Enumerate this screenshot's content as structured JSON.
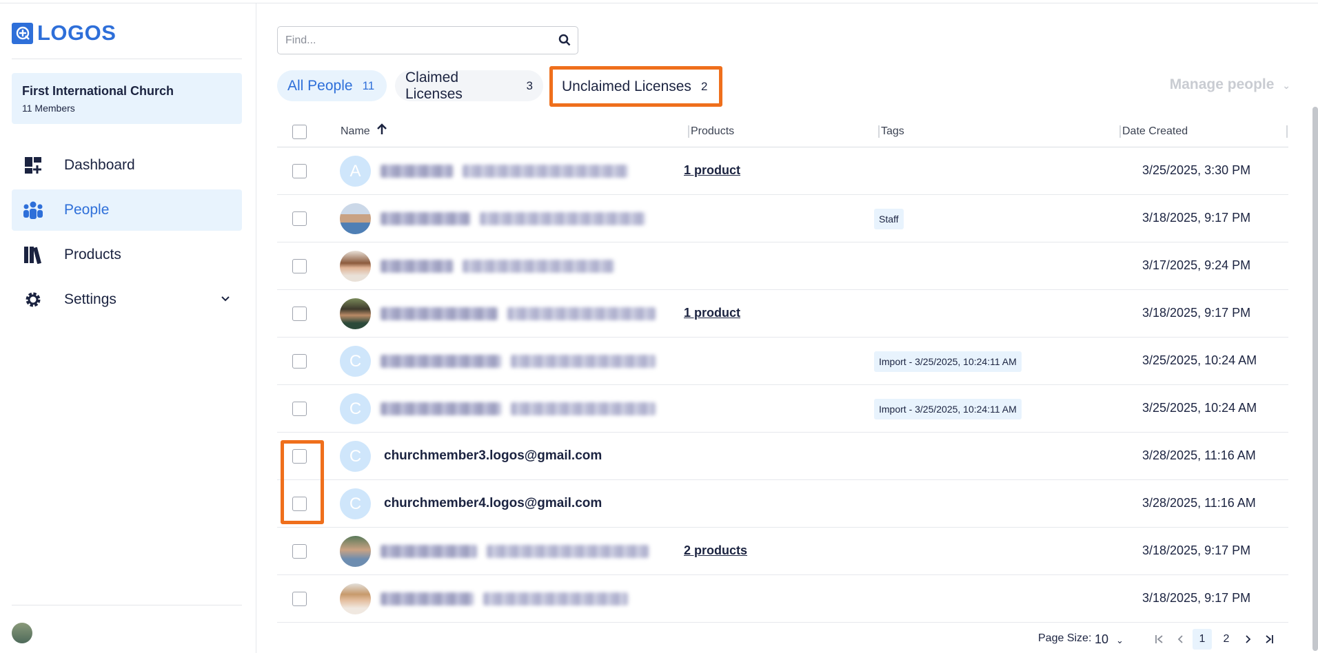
{
  "app": {
    "logo_text": "LOGOS"
  },
  "sidebar": {
    "org_name": "First International Church",
    "org_members": "11 Members",
    "items": [
      {
        "label": "Dashboard",
        "icon": "dashboard-icon"
      },
      {
        "label": "People",
        "icon": "people-icon",
        "active": true
      },
      {
        "label": "Products",
        "icon": "books-icon"
      },
      {
        "label": "Settings",
        "icon": "gear-icon"
      }
    ]
  },
  "search": {
    "placeholder": "Find..."
  },
  "tabs": [
    {
      "label": "All People",
      "count": "11",
      "active": true
    },
    {
      "label": "Claimed Licenses",
      "count": "3"
    },
    {
      "label": "Unclaimed Licenses",
      "count": "2",
      "highlighted": true
    }
  ],
  "manage_label": "Manage people",
  "columns": {
    "name": "Name",
    "products": "Products",
    "tags": "Tags",
    "date": "Date Created"
  },
  "rows": [
    {
      "avatar": "A",
      "name_visible": false,
      "products": "1 product",
      "tag": "",
      "date": "3/25/2025, 3:30 PM"
    },
    {
      "avatar": "photo",
      "name_visible": false,
      "products": "",
      "tag": "Staff",
      "date": "3/18/2025, 9:17 PM"
    },
    {
      "avatar": "photo",
      "name_visible": false,
      "products": "",
      "tag": "",
      "date": "3/17/2025, 9:24 PM"
    },
    {
      "avatar": "photo",
      "name_visible": false,
      "products": "1 product",
      "tag": "",
      "date": "3/18/2025, 9:17 PM"
    },
    {
      "avatar": "C",
      "name_visible": false,
      "products": "",
      "tag": "Import - 3/25/2025, 10:24:11 AM",
      "date": "3/25/2025, 10:24 AM"
    },
    {
      "avatar": "C",
      "name_visible": false,
      "products": "",
      "tag": "Import - 3/25/2025, 10:24:11 AM",
      "date": "3/25/2025, 10:24 AM"
    },
    {
      "avatar": "C",
      "name_visible": true,
      "name": "churchmember3.logos@gmail.com",
      "products": "",
      "tag": "",
      "date": "3/28/2025, 11:16 AM"
    },
    {
      "avatar": "C",
      "name_visible": true,
      "name": "churchmember4.logos@gmail.com",
      "products": "",
      "tag": "",
      "date": "3/28/2025, 11:16 AM"
    },
    {
      "avatar": "photo",
      "name_visible": false,
      "products": "2 products",
      "tag": "",
      "date": "3/18/2025, 9:17 PM"
    },
    {
      "avatar": "photo",
      "name_visible": false,
      "products": "",
      "tag": "",
      "date": "3/18/2025, 9:17 PM"
    }
  ],
  "pagination": {
    "page_size_label": "Page Size:",
    "page_size": "10",
    "pages": [
      "1",
      "2"
    ],
    "current": "1"
  },
  "colors": {
    "accent": "#2e6fd9",
    "highlight": "#ef6f1c",
    "active_bg": "#e8f3fd"
  }
}
